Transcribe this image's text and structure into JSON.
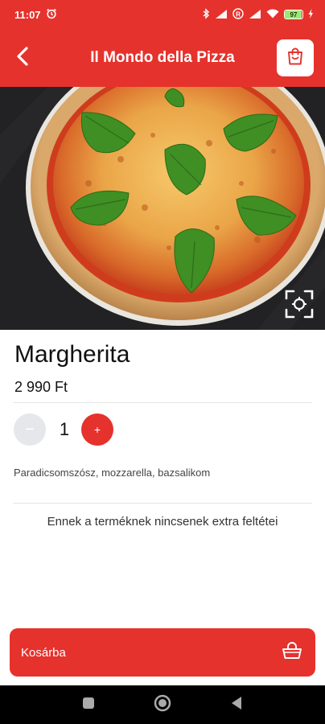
{
  "status_bar": {
    "time": "11:07",
    "battery_percent": "97",
    "battery_level": 0.97,
    "icons": [
      "alarm-icon",
      "bluetooth-icon",
      "cellular-signal-icon",
      "roaming-icon",
      "wifi-icon",
      "battery-icon",
      "charging-icon"
    ]
  },
  "header": {
    "title": "Il Mondo della Pizza",
    "back_icon": "chevron-left-icon",
    "cart_icon": "shopping-bag-icon"
  },
  "product": {
    "name": "Margherita",
    "price": "2 990 Ft",
    "quantity": "1",
    "minus_label": "−",
    "plus_label": "+",
    "ingredients": "Paradicsomszósz, mozzarella, bazsalikom",
    "extras_note": "Ennek a terméknek nincsenek extra feltétei"
  },
  "actions": {
    "add_to_cart_label": "Kosárba",
    "add_to_cart_icon": "basket-icon",
    "fullscreen_icon": "fullscreen-scan-icon"
  },
  "nav_bar": {
    "icons": [
      "recents-square-icon",
      "home-circle-icon",
      "back-triangle-icon"
    ]
  },
  "colors": {
    "brand_red": "#e5322d",
    "minus_button_gray": "#e5e7ea",
    "nav_bar": "#000000"
  }
}
